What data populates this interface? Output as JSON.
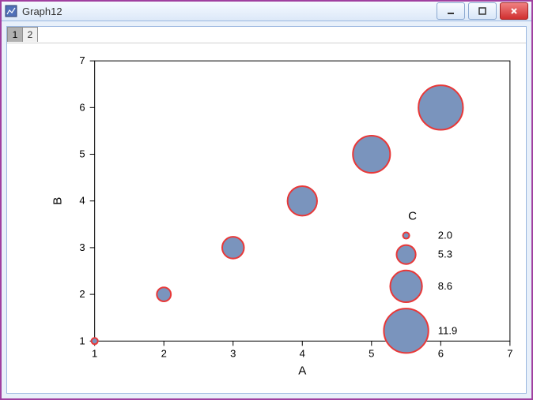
{
  "window": {
    "title": "Graph12"
  },
  "tabs": [
    {
      "label": "1",
      "active": true
    },
    {
      "label": "2",
      "active": false
    }
  ],
  "chart_data": {
    "type": "scatter",
    "subtype": "bubble",
    "xlabel": "A",
    "ylabel": "B",
    "xlim": [
      1,
      7
    ],
    "ylim": [
      1,
      7
    ],
    "x_ticks": [
      1,
      2,
      3,
      4,
      5,
      6,
      7
    ],
    "y_ticks": [
      1,
      2,
      3,
      4,
      5,
      6,
      7
    ],
    "x": [
      1,
      2,
      3,
      4,
      5,
      6
    ],
    "y": [
      1,
      2,
      3,
      4,
      5,
      6
    ],
    "size": [
      2.0,
      4.0,
      6.0,
      8.0,
      10.0,
      11.9
    ],
    "bubble_fill": "#7a94bd",
    "bubble_stroke": "#e83838",
    "legend": {
      "title": "C",
      "entries": [
        {
          "value": 2.0,
          "label": "2.0"
        },
        {
          "value": 5.3,
          "label": "5.3"
        },
        {
          "value": 8.6,
          "label": "8.6"
        },
        {
          "value": 11.9,
          "label": "11.9"
        }
      ]
    }
  }
}
